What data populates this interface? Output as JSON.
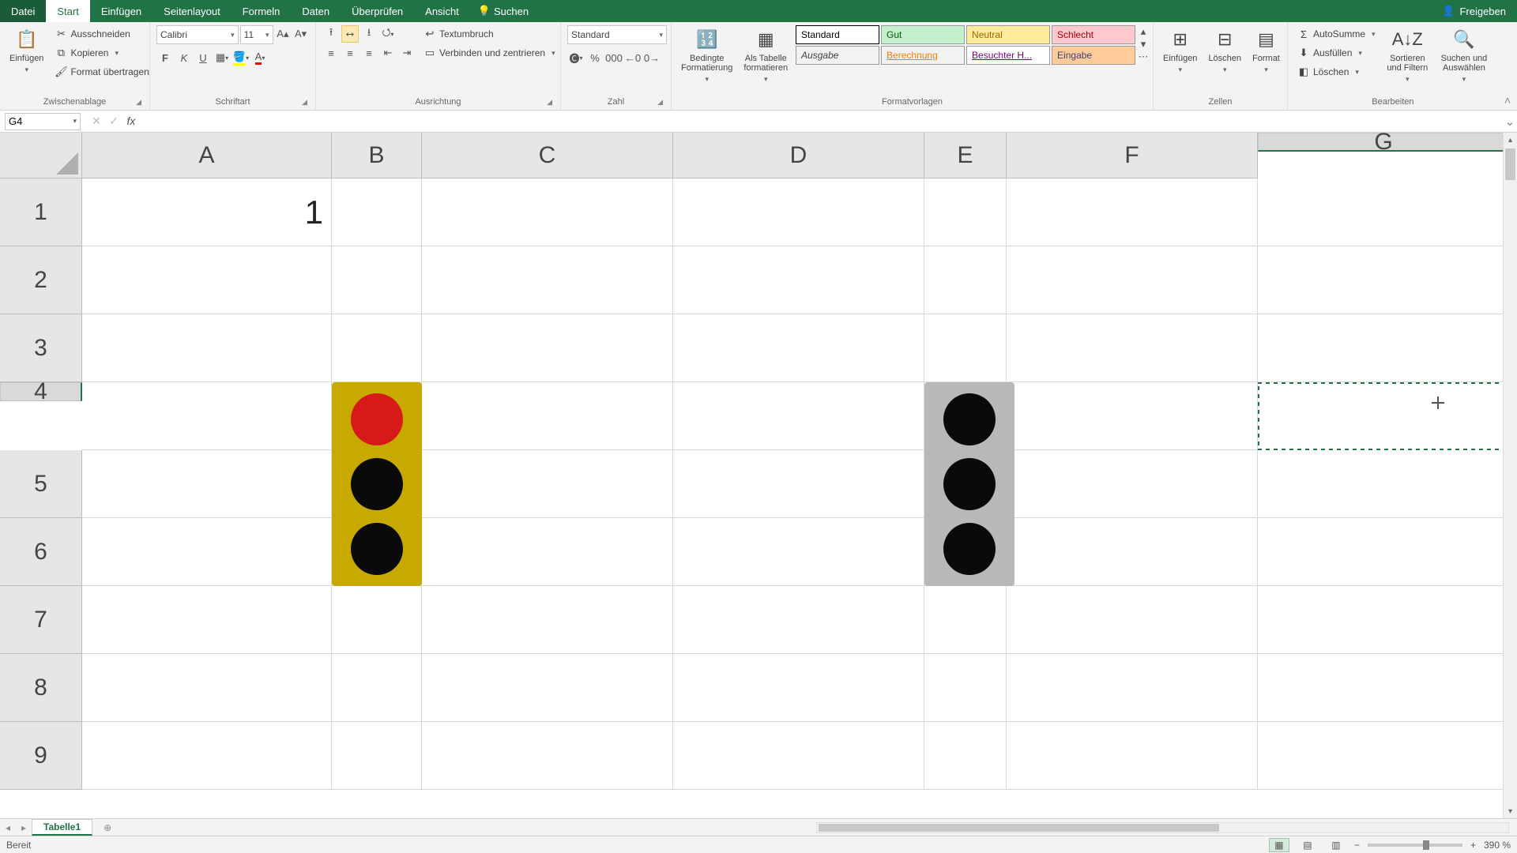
{
  "titlebar": {
    "file": "Datei",
    "tabs": [
      "Start",
      "Einfügen",
      "Seitenlayout",
      "Formeln",
      "Daten",
      "Überprüfen",
      "Ansicht"
    ],
    "active_tab": "Start",
    "search_placeholder": "Suchen",
    "share": "Freigeben"
  },
  "ribbon": {
    "clipboard": {
      "paste": "Einfügen",
      "cut": "Ausschneiden",
      "copy": "Kopieren",
      "format_painter": "Format übertragen",
      "label": "Zwischenablage"
    },
    "font": {
      "name": "Calibri",
      "size": "11",
      "label": "Schriftart"
    },
    "alignment": {
      "wrap": "Textumbruch",
      "merge": "Verbinden und zentrieren",
      "label": "Ausrichtung"
    },
    "number": {
      "format": "Standard",
      "label": "Zahl"
    },
    "styles": {
      "cond_format": "Bedingte Formatierung",
      "as_table": "Als Tabelle formatieren",
      "cells": [
        {
          "text": "Standard",
          "bg": "#ffffff",
          "color": "#000",
          "border": "#000"
        },
        {
          "text": "Gut",
          "bg": "#c6efce",
          "color": "#006100"
        },
        {
          "text": "Neutral",
          "bg": "#ffeb9c",
          "color": "#9c6500"
        },
        {
          "text": "Schlecht",
          "bg": "#ffc7ce",
          "color": "#9c0006"
        },
        {
          "text": "Ausgabe",
          "bg": "#f2f2f2",
          "color": "#3f3f3f",
          "italic": true
        },
        {
          "text": "Berechnung",
          "bg": "#f2f2f2",
          "color": "#fa7d00",
          "underline": true
        },
        {
          "text": "Besuchter H...",
          "bg": "#ffffff",
          "color": "#800080",
          "underline": true
        },
        {
          "text": "Eingabe",
          "bg": "#ffcc99",
          "color": "#3f3f76"
        }
      ],
      "label": "Formatvorlagen"
    },
    "cells_group": {
      "insert": "Einfügen",
      "delete": "Löschen",
      "format": "Format",
      "label": "Zellen"
    },
    "editing": {
      "autosum": "AutoSumme",
      "fill": "Ausfüllen",
      "clear": "Löschen",
      "sort": "Sortieren und Filtern",
      "find": "Suchen und Auswählen",
      "label": "Bearbeiten"
    }
  },
  "formula_bar": {
    "name_box": "G4",
    "formula": ""
  },
  "grid": {
    "columns": [
      "A",
      "B",
      "C",
      "D",
      "E",
      "F",
      "G"
    ],
    "rows": [
      "1",
      "2",
      "3",
      "4",
      "5",
      "6",
      "7",
      "8",
      "9"
    ],
    "selected_cell": "G4",
    "selected_col": "G",
    "selected_row": "4",
    "cells": {
      "A1": "1"
    },
    "shapes": {
      "traffic_light_1": {
        "col": "B",
        "row_start": 4,
        "body_color": "#c7a900",
        "lamps": [
          "#d61a1a",
          "#0a0a0a",
          "#0a0a0a"
        ]
      },
      "traffic_light_2": {
        "col": "E",
        "row_start": 4,
        "body_color": "#b8b8b8",
        "lamps": [
          "#0a0a0a",
          "#0a0a0a",
          "#0a0a0a"
        ]
      }
    }
  },
  "sheet_tabs": {
    "active": "Tabelle1"
  },
  "status_bar": {
    "status": "Bereit",
    "zoom": "390 %"
  }
}
